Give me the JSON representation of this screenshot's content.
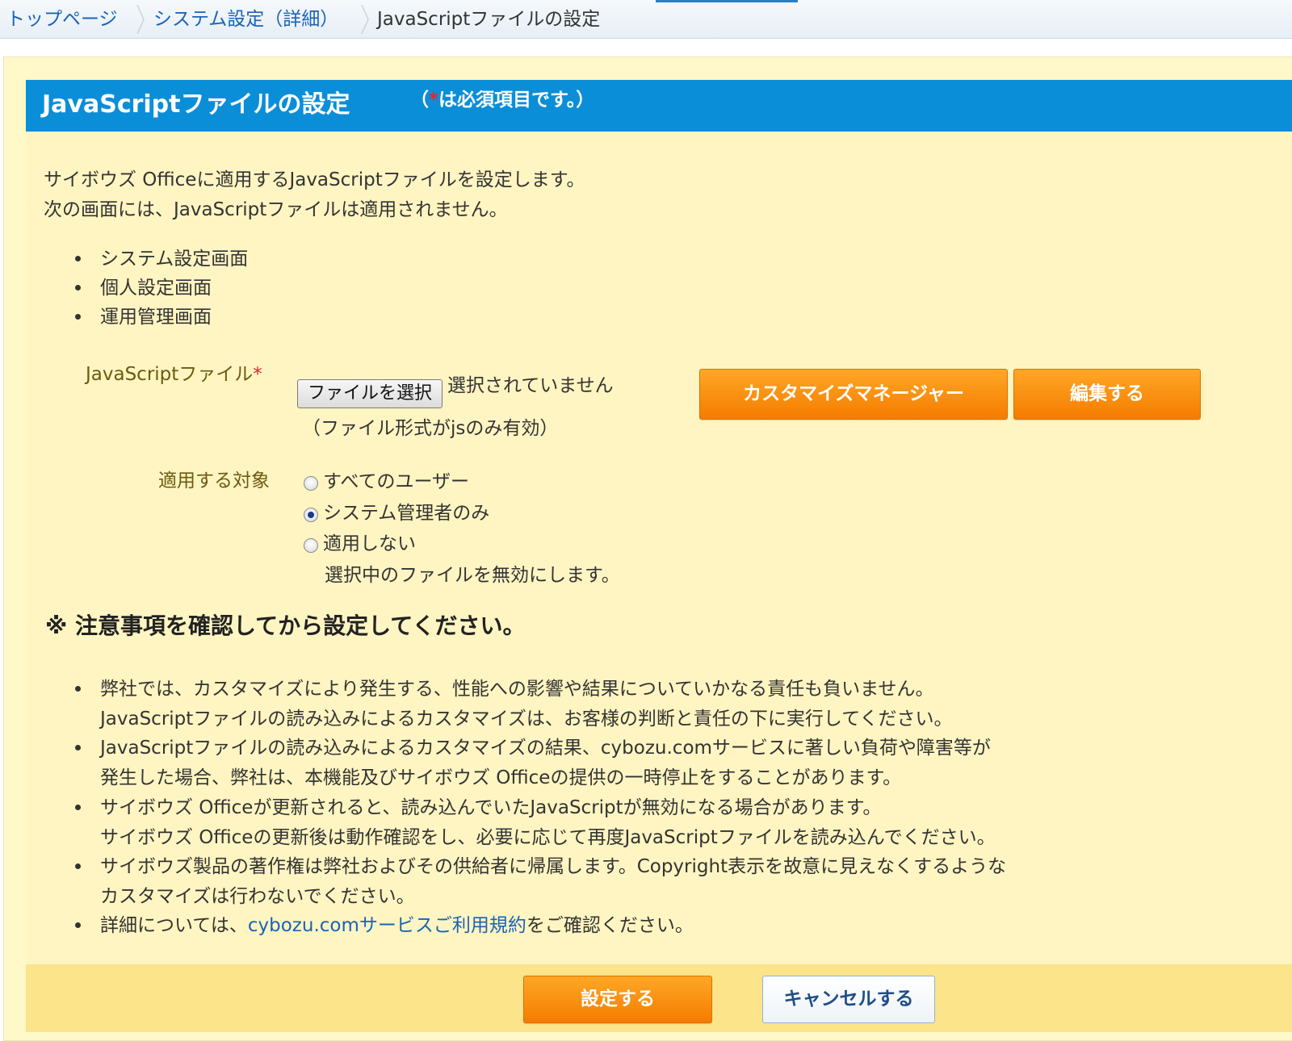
{
  "breadcrumb": {
    "items": [
      {
        "label": "トップページ"
      },
      {
        "label": "システム設定（詳細）"
      },
      {
        "label": "JavaScriptファイルの設定"
      }
    ]
  },
  "header": {
    "title": "JavaScriptファイルの設定",
    "note_prefix": "（",
    "note_star": "*",
    "note_suffix": "は必須項目です。）"
  },
  "intro": {
    "line1": "サイボウズ Officeに適用するJavaScriptファイルを設定します。",
    "line2": "次の画面には、JavaScriptファイルは適用されません。",
    "excluded_screens": [
      "システム設定画面",
      "個人設定画面",
      "運用管理画面"
    ]
  },
  "form": {
    "file_label": "JavaScriptファイル",
    "required_star": "*",
    "choose_file_button": "ファイルを選択",
    "no_file_text": "選択されていません",
    "file_format_note": "（ファイル形式がjsのみ有効）",
    "customize_manager_button": "カスタマイズマネージャー",
    "edit_button": "編集する",
    "target_label": "適用する対象",
    "target_options": [
      {
        "label": "すべてのユーザー",
        "checked": false
      },
      {
        "label": "システム管理者のみ",
        "checked": true
      },
      {
        "label": "適用しない",
        "checked": false
      }
    ],
    "disable_note": "選択中のファイルを無効にします。"
  },
  "notice": {
    "title": "※ 注意事項を確認してから設定してください。",
    "items": [
      {
        "lines": [
          "弊社では、カスタマイズにより発生する、性能への影響や結果についていかなる責任も負いません。",
          "JavaScriptファイルの読み込みによるカスタマイズは、お客様の判断と責任の下に実行してください。"
        ]
      },
      {
        "lines": [
          "JavaScriptファイルの読み込みによるカスタマイズの結果、cybozu.comサービスに著しい負荷や障害等が",
          "発生した場合、弊社は、本機能及びサイボウズ Officeの提供の一時停止をすることがあります。"
        ]
      },
      {
        "lines": [
          "サイボウズ Officeが更新されると、読み込んでいたJavaScriptが無効になる場合があります。",
          "サイボウズ Officeの更新後は動作確認をし、必要に応じて再度JavaScriptファイルを読み込んでください。"
        ]
      },
      {
        "lines": [
          "サイボウズ製品の著作権は弊社およびその供給者に帰属します。Copyright表示を故意に見えなくするような",
          "カスタマイズは行わないでください。"
        ]
      }
    ],
    "last_prefix": "詳細については、",
    "last_link": "cybozu.comサービスご利用規約",
    "last_suffix": "をご確認ください。"
  },
  "footer": {
    "submit_button": "設定する",
    "cancel_button": "キャンセルする"
  },
  "colors": {
    "title_bar": "#0b8ed8",
    "panel_bg": "#fff5c2",
    "footer_bg": "#fbe489",
    "orange_button": "#f57c00",
    "required": "#e8242d",
    "link": "#1a63b8"
  }
}
